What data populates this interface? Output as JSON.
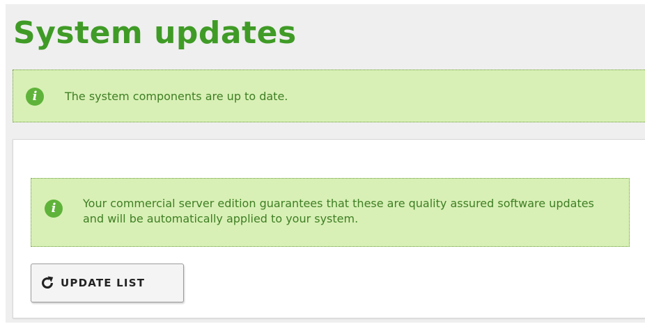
{
  "header": {
    "title": "System updates"
  },
  "status_notice": {
    "icon": "info-icon",
    "text": "The system components are up to date."
  },
  "panel": {
    "notice": {
      "icon": "info-icon",
      "text": "Your commercial server edition guarantees that these are quality assured software updates and will be automatically applied to your system."
    },
    "update_button": {
      "icon": "refresh-icon",
      "label": "UPDATE LIST"
    }
  },
  "colors": {
    "title_green": "#3f9b26",
    "notice_bg": "#d8f0b5",
    "notice_text": "#3e7e24",
    "icon_green": "#5fb33a",
    "page_bg": "#efefef"
  }
}
